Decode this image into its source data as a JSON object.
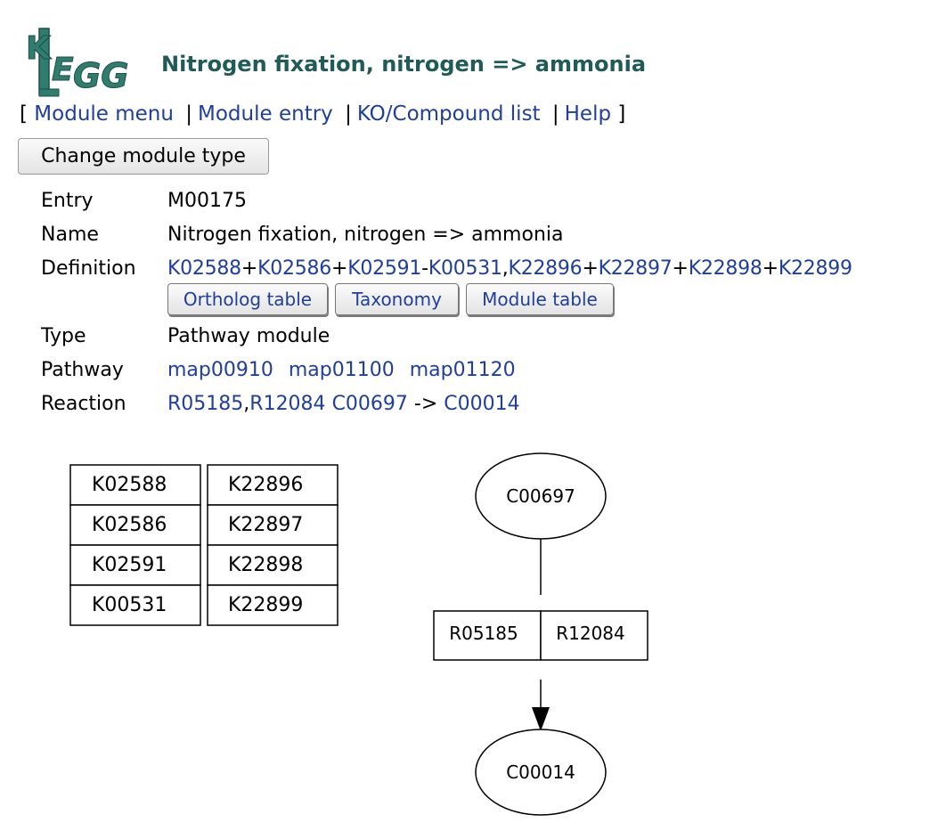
{
  "header": {
    "logo_text": "KEGG",
    "title": "Nitrogen fixation, nitrogen => ammonia"
  },
  "nav": {
    "open_bracket": "[",
    "close_bracket": "]",
    "separator": "|",
    "module_menu": "Module menu",
    "module_entry": "Module entry",
    "ko_compound_list": "KO/Compound list",
    "help": "Help"
  },
  "change_button": "Change module type",
  "fields": {
    "entry_label": "Entry",
    "entry_value": "M00175",
    "name_label": "Name",
    "name_value": "Nitrogen fixation, nitrogen => ammonia",
    "definition_label": "Definition",
    "definition": {
      "k1": "K02588",
      "op1": "+",
      "k2": "K02586",
      "op2": "+",
      "k3": "K02591",
      "op3": "-",
      "k4": "K00531",
      "op4": ",",
      "k5": "K22896",
      "op5": "+",
      "k6": "K22897",
      "op6": "+",
      "k7": "K22898",
      "op7": "+",
      "k8": "K22899"
    },
    "type_label": "Type",
    "type_value": "Pathway module",
    "pathway_label": "Pathway",
    "pathways": [
      "map00910",
      "map01100",
      "map01120"
    ],
    "reaction_label": "Reaction",
    "reaction": {
      "r1": "R05185",
      "comma": ",",
      "r2": "R12084",
      "substrate": "C00697",
      "arrow": "->",
      "product": "C00014"
    }
  },
  "definition_buttons": {
    "ortholog_table": "Ortholog table",
    "taxonomy": "Taxonomy",
    "module_table": "Module table"
  },
  "diagram": {
    "ko_table_left": [
      "K02588",
      "K02586",
      "K02591",
      "K00531"
    ],
    "ko_table_right": [
      "K22896",
      "K22897",
      "K22898",
      "K22899"
    ],
    "substrate": "C00697",
    "reactions": [
      "R05185",
      "R12084"
    ],
    "product": "C00014"
  },
  "colors": {
    "link": "#1f3f9b",
    "title": "#1f5c57",
    "logo": "#2e7d6e"
  }
}
